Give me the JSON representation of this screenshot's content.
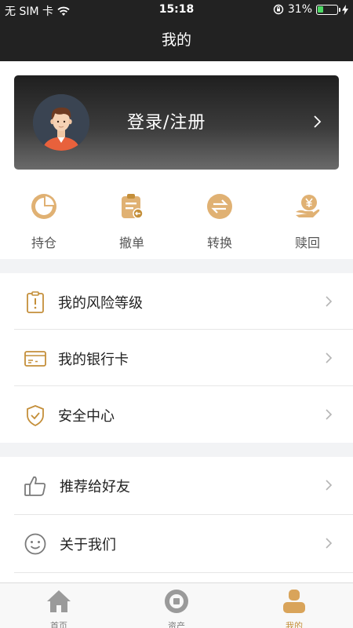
{
  "status_bar": {
    "carrier": "无 SIM 卡",
    "time": "15:18",
    "battery_percent_text": "31%",
    "battery_level": 0.31
  },
  "nav": {
    "title": "我的"
  },
  "profile_card": {
    "login_label": "登录/注册"
  },
  "quick_actions": [
    {
      "label": "持仓",
      "icon": "pie-chart-icon"
    },
    {
      "label": "撤单",
      "icon": "clipboard-cancel-icon"
    },
    {
      "label": "转换",
      "icon": "exchange-icon"
    },
    {
      "label": "赎回",
      "icon": "yen-hand-icon"
    }
  ],
  "menu_group_1": [
    {
      "label": "我的风险等级",
      "icon": "risk-level-icon"
    },
    {
      "label": "我的银行卡",
      "icon": "bank-card-icon"
    },
    {
      "label": "安全中心",
      "icon": "shield-icon"
    }
  ],
  "menu_group_2": [
    {
      "label": "推荐给好友",
      "icon": "thumbs-up-icon"
    },
    {
      "label": "关于我们",
      "icon": "smiley-icon"
    }
  ],
  "tab_bar": [
    {
      "label": "首页",
      "icon": "home-icon",
      "active": false
    },
    {
      "label": "资产",
      "icon": "assets-icon",
      "active": false
    },
    {
      "label": "我的",
      "icon": "profile-icon",
      "active": true
    }
  ],
  "colors": {
    "accent": "#d9a45a",
    "icon_outline": "#c48f3a",
    "inactive": "#9a9a9a",
    "header_bg": "#222222"
  }
}
